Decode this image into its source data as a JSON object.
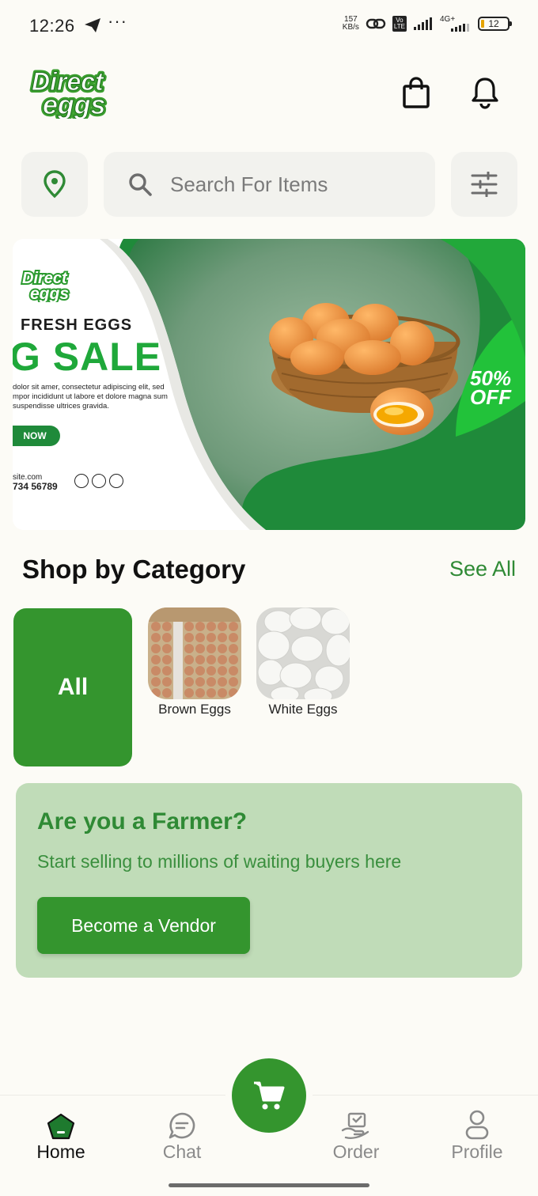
{
  "status_bar": {
    "time": "12:26",
    "net_speed_top": "157",
    "net_speed_bottom": "KB/s",
    "volte_top": "Vo",
    "volte_bottom": "LTE",
    "network": "4G+",
    "battery": "12"
  },
  "header": {
    "logo_line1": "Direct",
    "logo_line2": "eggs",
    "bag_icon": "shopping-bag-icon",
    "bell_icon": "bell-icon"
  },
  "search": {
    "placeholder": "Search For Items",
    "location_icon": "location-pin-icon",
    "filter_icon": "filter-sliders-icon"
  },
  "banner": {
    "brand_line1": "Direct",
    "brand_line2": "eggs",
    "fresh": "FRESH EGGS",
    "sale": "G SALE",
    "lorem": "dolor sit amer, consectetur adipiscing elit, sed mpor incididunt ut labore et dolore magna sum suspendisse ultrices gravida.",
    "cta": "NOW",
    "site": "site.com",
    "phone": "734 56789",
    "off_line1": "50%",
    "off_line2": "OFF",
    "colors": {
      "green": "#1f8a3a",
      "bright_green": "#22c23a"
    }
  },
  "category": {
    "title": "Shop by Category",
    "see_all": "See All",
    "all_label": "All",
    "items": [
      {
        "label": "Brown Eggs"
      },
      {
        "label": "White Eggs"
      }
    ]
  },
  "farmer": {
    "title": "Are you a Farmer?",
    "subtitle": "Start selling to millions of waiting buyers here",
    "button": "Become a Vendor"
  },
  "nav": {
    "items": [
      {
        "label": "Home",
        "icon": "home-pentagon-icon",
        "active": true
      },
      {
        "label": "Chat",
        "icon": "chat-bubble-icon",
        "active": false
      },
      {
        "label": "Order",
        "icon": "order-hand-icon",
        "active": false
      },
      {
        "label": "Profile",
        "icon": "profile-user-icon",
        "active": false
      }
    ],
    "cart_icon": "cart-icon"
  },
  "theme": {
    "primary": "#34952e",
    "card_bg": "#c0dcb8",
    "page_bg": "#fcfbf6"
  }
}
